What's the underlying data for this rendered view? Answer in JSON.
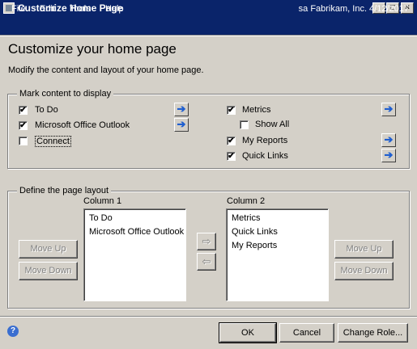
{
  "window": {
    "title": "Customize Home Page"
  },
  "caption_buttons": {
    "minimize": "_",
    "maximize": "□",
    "close": "×"
  },
  "menu": {
    "items": [
      "File",
      "Edit",
      "Tools",
      "Help"
    ]
  },
  "user": {
    "info": "sa  Fabrikam, Inc.  4/12/2017"
  },
  "page": {
    "heading": "Customize your home page",
    "subheading": "Modify the content and layout of your home page."
  },
  "content_group": {
    "legend": "Mark content to display",
    "left": [
      {
        "label": "To Do",
        "checked": true,
        "mark": "✔"
      },
      {
        "label": "Microsoft Office Outlook",
        "checked": true,
        "mark": "✔"
      },
      {
        "label": "Connect",
        "checked": false,
        "mark": ""
      }
    ],
    "right": [
      {
        "label": "Metrics",
        "checked": true,
        "mark": "✔"
      },
      {
        "label": "Show All",
        "checked": false,
        "mark": ""
      },
      {
        "label": "My Reports",
        "checked": true,
        "mark": "✔"
      },
      {
        "label": "Quick Links",
        "checked": true,
        "mark": "✔"
      }
    ],
    "arrow_glyph": "➔"
  },
  "layout_group": {
    "legend": "Define the page layout",
    "column1": {
      "label": "Column 1",
      "items": [
        "To Do",
        "Microsoft Office Outlook"
      ]
    },
    "column2": {
      "label": "Column 2",
      "items": [
        "Metrics",
        "Quick Links",
        "My Reports"
      ]
    },
    "move_up_label": "Move Up",
    "move_down_label": "Move Down",
    "move_right_glyph": "⇨",
    "move_left_glyph": "⇦"
  },
  "footer": {
    "help_glyph": "?",
    "ok_label": "OK",
    "cancel_label": "Cancel",
    "change_role_label": "Change Role..."
  },
  "colors": {
    "titlebar": "#0a246a",
    "window": "#d4d0c8",
    "arrow": "#1f5fd0"
  }
}
